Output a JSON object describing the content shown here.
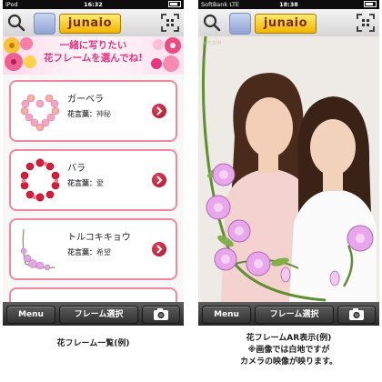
{
  "left_screen": {
    "status": {
      "carrier": "iPod",
      "time": "16:32"
    },
    "logo_text": "junaio",
    "banner": {
      "line1": "一緒に写りたい",
      "line2": "花フレームを選んでね!"
    },
    "meaning_label": "花言葉：",
    "frames": [
      {
        "name": "ガーベラ",
        "meaning": "神秘"
      },
      {
        "name": "バラ",
        "meaning": "愛"
      },
      {
        "name": "トルコキキョウ",
        "meaning": "希望"
      }
    ],
    "bottom": {
      "menu": "Menu",
      "frame_select": "フレーム選択"
    }
  },
  "right_screen": {
    "status": {
      "carrier": "SoftBank LTE",
      "time": "18:38"
    },
    "logo_text": "junaio",
    "watermark": "junaio",
    "bottom": {
      "menu": "Menu",
      "frame_select": "フレーム選択"
    }
  },
  "captions": {
    "left": "花フレーム一覧(例)",
    "right_line1": "花フレームAR表示(例)",
    "right_line2": "※画像では白地ですが",
    "right_line3": "カメラの映像が映ります。"
  },
  "colors": {
    "accent_pink": "#e8337f",
    "card_border": "#f0889f",
    "arrow_red": "#c0203a"
  },
  "icons": [
    "search-icon",
    "app-icon",
    "qr-scan-icon",
    "chevron-right-icon",
    "camera-icon",
    "wifi-icon",
    "battery-icon"
  ]
}
